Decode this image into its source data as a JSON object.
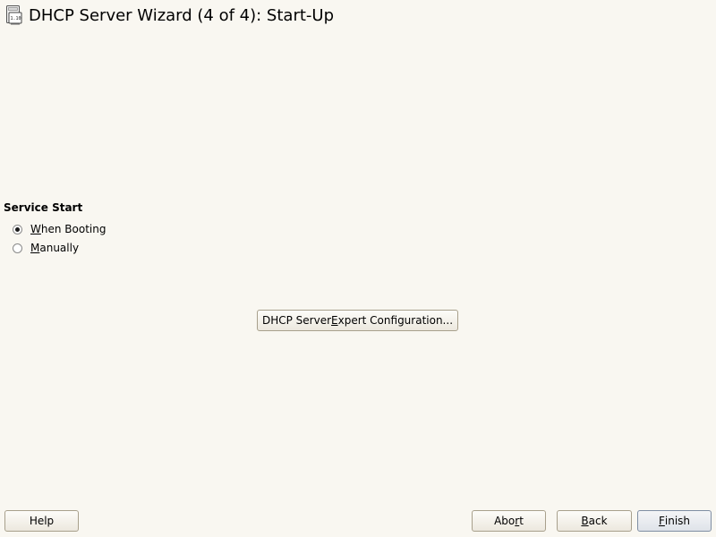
{
  "header": {
    "title": "DHCP Server Wizard (4 of 4): Start-Up",
    "icon": "network-server-icon"
  },
  "service_start": {
    "group_title": "Service Start",
    "options": [
      {
        "pre": "",
        "mnemonic": "W",
        "post": "hen Booting",
        "selected": true
      },
      {
        "pre": "",
        "mnemonic": "M",
        "post": "anually",
        "selected": false
      }
    ]
  },
  "expert_button": {
    "pre": "DHCP Server ",
    "mnemonic": "E",
    "post": "xpert Configuration..."
  },
  "footer": {
    "help": {
      "pre": "Help",
      "mnemonic": "",
      "post": ""
    },
    "abort": {
      "pre": "Abo",
      "mnemonic": "r",
      "post": "t"
    },
    "back": {
      "pre": "",
      "mnemonic": "B",
      "post": "ack"
    },
    "finish": {
      "pre": "",
      "mnemonic": "F",
      "post": "inish"
    }
  },
  "colors": {
    "background": "#f9f7f1",
    "button_border": "#a8a08c",
    "default_button_border": "#7f8ea3"
  }
}
